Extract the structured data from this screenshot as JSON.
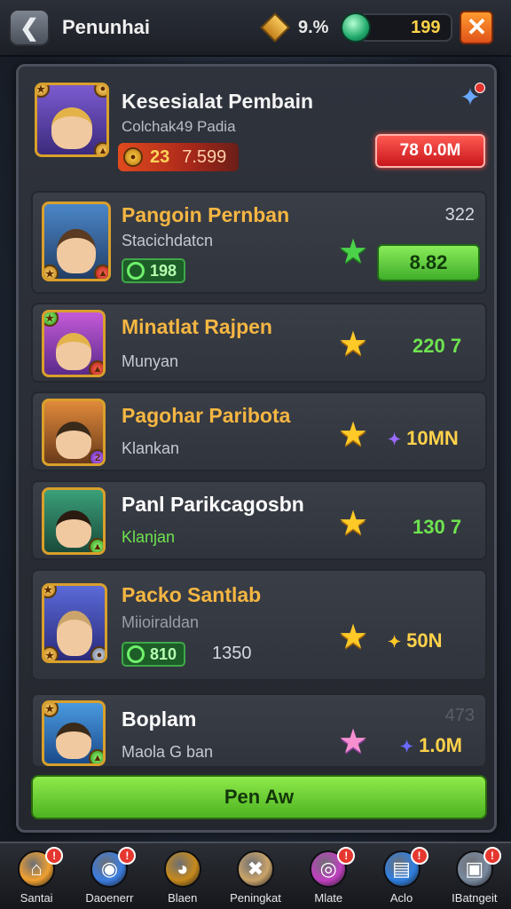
{
  "topbar": {
    "title": "Penunhai",
    "coins": "9.%",
    "gems": "199"
  },
  "header": {
    "name": "Kesesialat Pembain",
    "subtitle": "Colchak49 Padia",
    "level": "23",
    "rank": "7.599",
    "button_label": "78 0.0M"
  },
  "rows": [
    {
      "name": "Pangoin Pernban",
      "sub": "Stacichdatcn",
      "pill": "198",
      "side": "322",
      "value": "8.82",
      "name_color": "#f5b642"
    },
    {
      "name": "Minatlat Rajpen",
      "sub": "Munyan",
      "value": "220 7",
      "name_color": "#f5b642"
    },
    {
      "name": "Pagohar Paribota",
      "sub": "Klankan",
      "value": "10MN",
      "name_color": "#f5b642"
    },
    {
      "name": "Panl Parikcagosbn",
      "sub": "Klanjan",
      "value": "130 7",
      "name_color": "#ffffff"
    },
    {
      "name": "Packo Santlab",
      "sub": "Miioiraldan",
      "pill": "810",
      "pill_extra": "1350",
      "value": "50N",
      "name_color": "#f5b642"
    },
    {
      "name": "Boplam",
      "sub": "Maola G ban",
      "side": "473",
      "value": "1.0M",
      "name_color": "#ffffff"
    }
  ],
  "main_button": "Pen Aw",
  "nav": [
    {
      "label": "Santai",
      "badge": "!",
      "color": "#f0a030"
    },
    {
      "label": "Daoenerr",
      "badge": "!",
      "color": "#3b7de0"
    },
    {
      "label": "Blaen",
      "badge": "",
      "color": "#c78a1c"
    },
    {
      "label": "Peningkat",
      "badge": "",
      "color": "#caa46a"
    },
    {
      "label": "Mlate",
      "badge": "!",
      "color": "#c040c0"
    },
    {
      "label": "Aclo",
      "badge": "!",
      "color": "#2f7fe0"
    },
    {
      "label": "IBatngeit",
      "badge": "!",
      "color": "#7a8aa0"
    }
  ]
}
